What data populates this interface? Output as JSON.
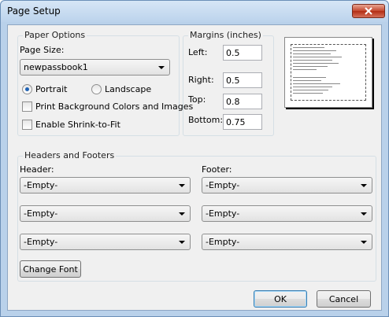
{
  "window": {
    "title": "Page Setup"
  },
  "paper_options": {
    "title": "Paper Options",
    "page_size_label": "Page Size:",
    "page_size_value": "newpassbook1",
    "portrait_label": "Portrait",
    "landscape_label": "Landscape",
    "print_bg_label": "Print Background Colors and Images",
    "shrink_label": "Enable Shrink-to-Fit",
    "orientation_selected": "Portrait",
    "print_bg_checked": false,
    "shrink_checked": false
  },
  "margins": {
    "title": "Margins (inches)",
    "left_label": "Left:",
    "left_value": "0.5",
    "right_label": "Right:",
    "right_value": "0.5",
    "top_label": "Top:",
    "top_value": "0.8",
    "bottom_label": "Bottom:",
    "bottom_value": "0.75"
  },
  "headers_footers": {
    "title": "Headers and Footers",
    "header_label": "Header:",
    "footer_label": "Footer:",
    "header_values": [
      "-Empty-",
      "-Empty-",
      "-Empty-"
    ],
    "footer_values": [
      "-Empty-",
      "-Empty-",
      "-Empty-"
    ],
    "change_font_label": "Change Font"
  },
  "buttons": {
    "ok": "OK",
    "cancel": "Cancel"
  },
  "icons": {
    "close": "close-icon",
    "dropdown": "chevron-down-icon"
  },
  "colors": {
    "title_bar": "#bcd3ec",
    "client_bg": "#f0f0f0",
    "close_button": "#c4472e",
    "radio_selected": "#1f62b4"
  }
}
